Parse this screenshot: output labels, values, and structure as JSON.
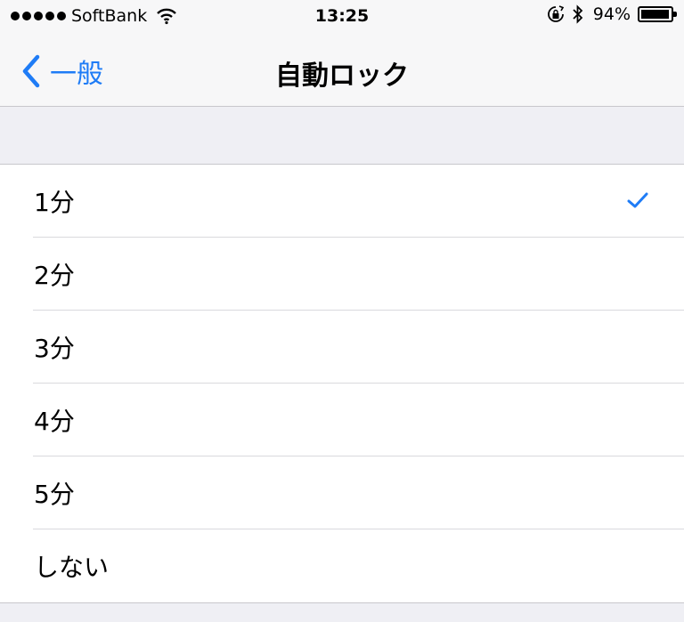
{
  "status_bar": {
    "carrier": "SoftBank",
    "time": "13:25",
    "battery_percent": "94%",
    "battery_level": 0.94,
    "signal_bars": 5,
    "icons": [
      "signal-icon",
      "wifi-icon",
      "rotation-lock-icon",
      "bluetooth-icon",
      "battery-icon"
    ]
  },
  "nav": {
    "back_label": "一般",
    "title": "自動ロック"
  },
  "options": [
    {
      "label": "1分",
      "selected": true
    },
    {
      "label": "2分",
      "selected": false
    },
    {
      "label": "3分",
      "selected": false
    },
    {
      "label": "4分",
      "selected": false
    },
    {
      "label": "5分",
      "selected": false
    },
    {
      "label": "しない",
      "selected": false
    }
  ],
  "colors": {
    "accent": "#1f7cf6",
    "background": "#efeff4",
    "separator": "#c8c7cc"
  }
}
